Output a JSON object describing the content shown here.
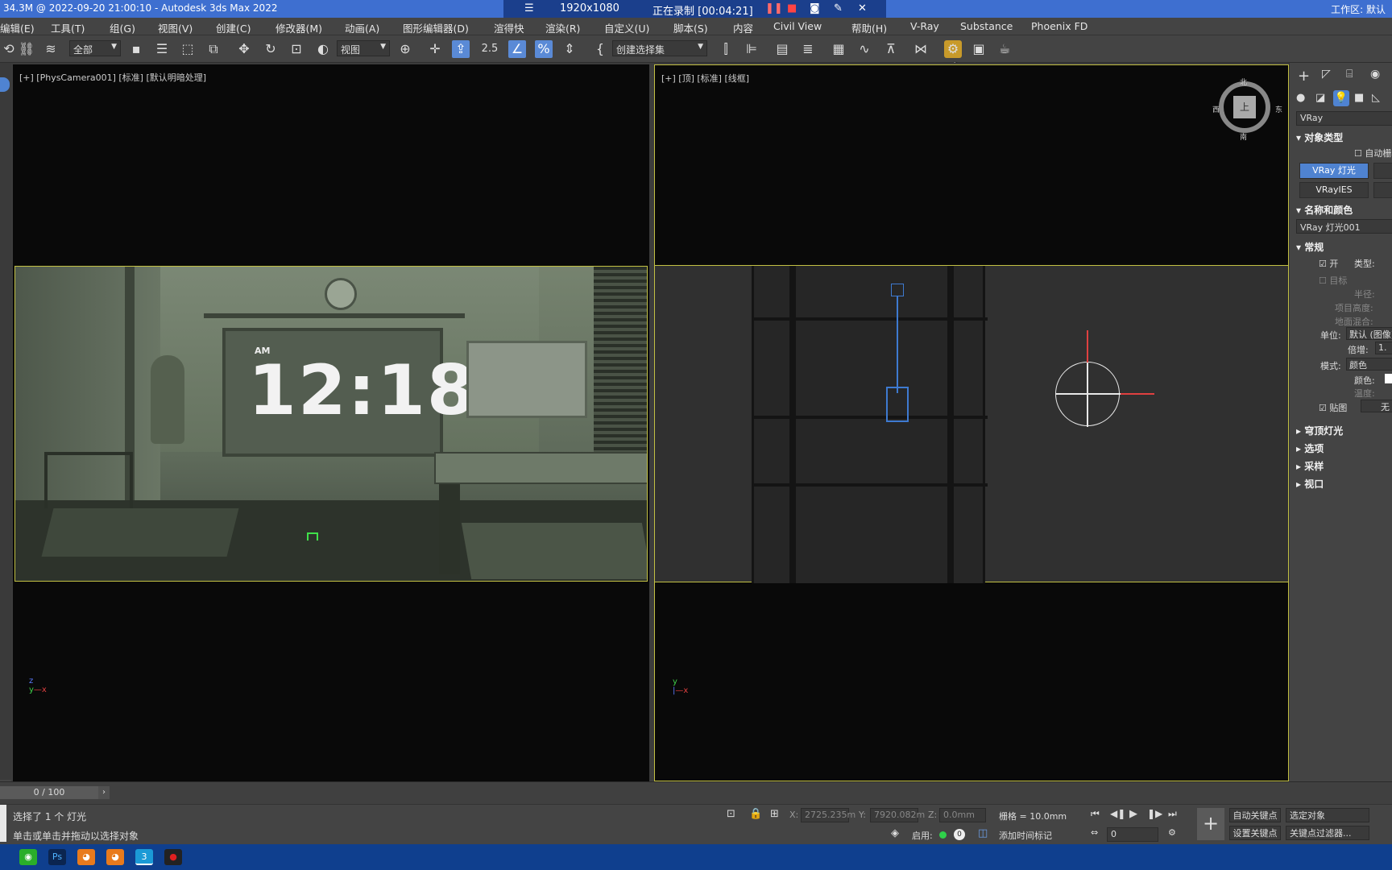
{
  "window": {
    "title": "34.3M @ 2022-09-20 21:00:10 - Autodesk 3ds Max 2022",
    "workspace": "工作区: 默认"
  },
  "recorder": {
    "resolution": "1920x1080",
    "status": "正在录制 [00:04:21]"
  },
  "menu": [
    "编辑(E)",
    "工具(T)",
    "组(G)",
    "视图(V)",
    "创建(C)",
    "修改器(M)",
    "动画(A)",
    "图形编辑器(D)",
    "渲得快",
    "渲染(R)",
    "自定义(U)",
    "脚本(S)",
    "内容",
    "Civil View",
    "帮助(H)",
    "V-Ray",
    "Substance",
    "Phoenix FD"
  ],
  "toolbar": {
    "filter": "全部",
    "refcoord": "视图",
    "snap_number": "2.5",
    "selection_set": "创建选择集"
  },
  "viewports": {
    "top_left_label": "[+] [PhysCamera001] [标准] [默认明暗处理]",
    "top_right_label": "[+] [顶] [标准] [线框]",
    "clock_ampm": "AM",
    "clock_time": "12:18",
    "viewcube_face": "上",
    "viewcube_n": "北",
    "viewcube_s": "南",
    "viewcube_w": "西",
    "viewcube_e": "东"
  },
  "panel": {
    "category": "VRay",
    "object_type_header": "对象类型",
    "autogrid": "自动栅格",
    "btn_vraylight": "VRay 灯光",
    "btn_vrayies": "VRayIES",
    "name_color_header": "名称和颜色",
    "object_name": "VRay 灯光001",
    "general_header": "常规",
    "on_label": "开",
    "type_label": "类型:",
    "targeted_label": "目标",
    "radius_label": "半径:",
    "length_label": "项目高度:",
    "ground_label": "地面混合:",
    "units_label": "单位:",
    "units_value": "默认 (图像)",
    "multiplier_label": "倍增:",
    "multiplier_value": "1.",
    "mode_label": "模式:",
    "mode_value": "颜色",
    "color_label": "颜色:",
    "temp_label": "温度:",
    "texture_label": "贴图",
    "texture_value": "无",
    "rollouts": [
      "穹顶灯光",
      "选项",
      "采样",
      "视口"
    ]
  },
  "timeline": {
    "frame": "0 / 100"
  },
  "status": {
    "selection": "选择了 1 个 灯光",
    "prompt": "单击或单击并拖动以选择对象",
    "x_label": "X:",
    "x_value": "2725.235m",
    "y_label": "Y:",
    "y_value": "7920.082m",
    "z_label": "Z:",
    "z_value": "0.0mm",
    "grid": "栅格 = 10.0mm",
    "enable": "启用:",
    "add_time_tag": "添加时间标记",
    "auto_key": "自动关键点",
    "set_key": "设置关键点",
    "selected": "选定对象",
    "key_filters": "关键点过滤器...",
    "frame_value": "0"
  },
  "taskbar": [
    "wechat",
    "photoshop",
    "blender",
    "blender2",
    "3dsmax",
    "recorder"
  ]
}
